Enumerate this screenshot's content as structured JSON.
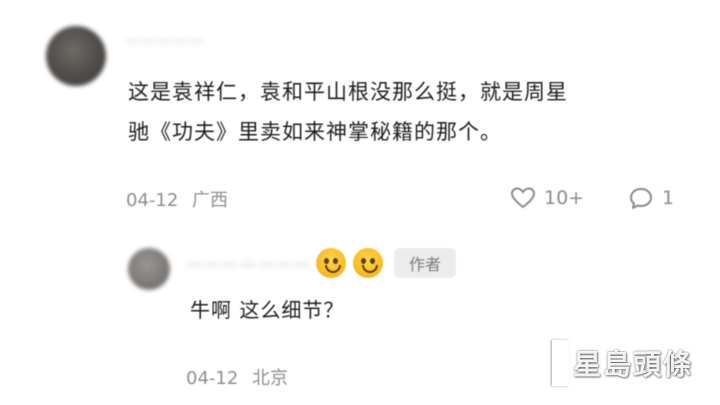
{
  "main_comment": {
    "username": "一一一一一",
    "text_line1": "这是袁祥仁，袁和平山根没那么挺，就是周星",
    "text_line2": "驰《功夫》里卖如来神掌秘籍的那个。",
    "date": "04-12",
    "location": "广西",
    "like_count": "10+",
    "reply_count": "1",
    "icons": {
      "like": "heart-icon",
      "reply": "comment-bubble-icon"
    }
  },
  "reply_comment": {
    "username": "一一一一一一一",
    "badge": "作者",
    "text": "牛啊 这么细节？",
    "date": "04-12",
    "location": "北京",
    "icons": {
      "emoji": "smile-emoji-icon"
    }
  },
  "watermark": {
    "text": "星島頭條"
  },
  "colors": {
    "text": "#1c1c1c",
    "meta": "#8e8e8e",
    "badge_bg": "#ececec"
  }
}
